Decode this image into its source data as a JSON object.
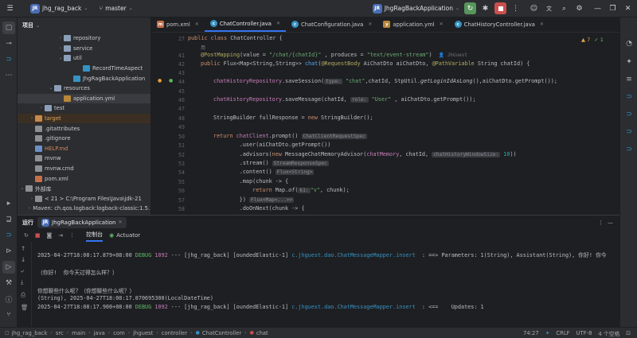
{
  "titlebar": {
    "project_badge": "JR",
    "project_name": "jhg_rag_back",
    "branch": "master",
    "run_config_badge": "JR",
    "run_config": "JhgRagBackApplication"
  },
  "project_panel": {
    "title": "项目",
    "rows": [
      {
        "label": "repository",
        "type": "folder",
        "arrow": "›",
        "indent": 50
      },
      {
        "label": "service",
        "type": "folder",
        "arrow": "›",
        "indent": 50
      },
      {
        "label": "util",
        "type": "folder",
        "arrow": "⌄",
        "indent": 50
      },
      {
        "label": "RecordTimeAspect",
        "type": "java",
        "arrow": "",
        "indent": 74
      },
      {
        "label": "JhgRagBackApplication",
        "type": "java",
        "arrow": "",
        "indent": 62
      },
      {
        "label": "resources",
        "type": "folder",
        "arrow": "⌄",
        "indent": 38
      },
      {
        "label": "application.yml",
        "type": "yml",
        "arrow": "",
        "indent": 50
      },
      {
        "label": "test",
        "type": "folder",
        "arrow": "›",
        "indent": 26
      },
      {
        "label": "target",
        "type": "folder-orange",
        "arrow": "›",
        "indent": 14
      },
      {
        "label": ".gitattributes",
        "type": "file",
        "arrow": "",
        "indent": 14
      },
      {
        "label": ".gitignore",
        "type": "file",
        "arrow": "",
        "indent": 14
      },
      {
        "label": "HELP.md",
        "type": "md",
        "arrow": "",
        "indent": 14
      },
      {
        "label": "mvnw",
        "type": "file",
        "arrow": "",
        "indent": 14
      },
      {
        "label": "mvnw.cmd",
        "type": "file",
        "arrow": "",
        "indent": 14
      },
      {
        "label": "pom.xml",
        "type": "xml",
        "arrow": "",
        "indent": 14
      },
      {
        "label": "外部库",
        "type": "lib",
        "arrow": "⌄",
        "indent": 2
      },
      {
        "label": "< 21 > C:\\Program Files\\Java\\jdk-21",
        "type": "lib",
        "arrow": "›",
        "indent": 14
      },
      {
        "label": "Maven: ch.qos.logback:logback-classic:1.5.1",
        "type": "lib",
        "arrow": "›",
        "indent": 14
      }
    ]
  },
  "tabs": [
    {
      "label": "pom.xml",
      "icon": "m"
    },
    {
      "label": "ChatController.java",
      "icon": "c",
      "active": true
    },
    {
      "label": "ChatConfiguration.java",
      "icon": "c"
    },
    {
      "label": "application.yml",
      "icon": "y"
    },
    {
      "label": "ChatHistoryController.java",
      "icon": "c"
    }
  ],
  "editor": {
    "warnings": "▲ 7",
    "ok": "✓ 1",
    "line_numbers": [
      "27",
      "",
      "41",
      "42",
      "43",
      "44",
      "45",
      "46",
      "47",
      "48",
      "49",
      "50",
      "51",
      "52",
      "53",
      "54",
      "55",
      "56",
      "57",
      "58",
      "59"
    ],
    "code": {
      "l27_kw": "public class",
      "l27_rest": " ChatController {",
      "usage": "用",
      "l41_ann": "@PostMapping",
      "l41_a": "(value = ",
      "l41_str": "\"/chat/{chatId}\"",
      "l41_b": " , produces = ",
      "l41_str2": "\"text/event-stream\"",
      "l41_c": ")",
      "l41_author": "JhGuest",
      "l42_kw": "public",
      "l42_a": " Flux<Map<String,String>> ",
      "l42_fn": "chat",
      "l42_b": "(",
      "l42_ann": "@RequestBody",
      "l42_c": " AiChatDto aiChatDto, ",
      "l42_ann2": "@PathVariable",
      "l42_d": " String chatId) {",
      "l44_fld": "chatHistoryRepository",
      "l44_a": ".saveSession(",
      "l44_hint": "type:",
      "l44_str": " \"chat\"",
      "l44_b": ",chatId, StpUtil.",
      "l44_it": "getLoginIdAsLong",
      "l44_c": "(),aiChatDto.getPrompt());",
      "l46_fld": "chatHistoryRepository",
      "l46_a": ".saveMessage(chatId, ",
      "l46_hint": "role:",
      "l46_str": " \"User\"",
      "l46_b": " , aiChatDto.getPrompt());",
      "l48_a": "StringBuilder fullResponse = ",
      "l48_kw": "new",
      "l48_b": " StringBuilder();",
      "l50_kw": "return",
      "l50_fld": " chatClient",
      "l50_a": ".prompt()",
      "l50_hint": "ChatClientRequestSpec",
      "l51": "        .user(aiChatDto.getPrompt())",
      "l52_a": "        .advisors(",
      "l52_kw": "new",
      "l52_b": " MessageChatMemoryAdvisor(",
      "l52_fld": "chatMemory",
      "l52_c": ", chatId, ",
      "l52_hint": "chatHistoryWindowSize:",
      "l52_num": " 10",
      "l52_d": "))",
      "l53": "        .stream()",
      "l53_hint": "StreamResponseSpec",
      "l54": "        .content()",
      "l54_hint": "Flux<String>",
      "l55": "        .map(chunk -> {",
      "l56_kw": "            return",
      "l56_a": " Map.",
      "l56_it": "of",
      "l56_b": "(",
      "l56_hint": "k1:",
      "l56_str": "\"v\"",
      "l56_c": ", chunk);",
      "l57": "        })",
      "l57_hint": "Flux<Map<...>>",
      "l58": "        .doOnNext(chunk -> {"
    }
  },
  "run_panel": {
    "title": "运行",
    "config": "JhgRagBackApplication",
    "tab_console": "控制台",
    "tab_actuator": "Actuator",
    "logs": {
      "l1_time": "2025-04-27T18:08:17.879+08:00",
      "l1_level": "DEBUG",
      "l1_pid": "1092",
      "l1_mid": " --- [jhg_rag_back] [oundedElastic-1] ",
      "l1_class": "c.jhguest.dao.ChatMessageMapper.insert",
      "l1_msg": "  : ==> Parameters: 1(String), Assistant(String), 你好! 你今",
      "l2": "（你好!  你今天过得怎么样？）",
      "l3": "你想聊些什么呢？（你想聊些什么呢？）",
      "l4": "(String), 2025-04-27T18:08:17.870695300(LocalDateTime)",
      "l5_time": "2025-04-27T18:08:17.900+08:00",
      "l5_level": "DEBUG",
      "l5_pid": "1092",
      "l5_mid": " --- [jhg_rag_back] [oundedElastic-1] ",
      "l5_class": "c.jhguest.dao.ChatMessageMapper.insert",
      "l5_msg": "  : <==    Updates: 1"
    }
  },
  "statusbar": {
    "breadcrumb": [
      "jhg_rag_back",
      "src",
      "main",
      "java",
      "com",
      "jhguest",
      "controller",
      "ChatController",
      "chat"
    ],
    "position": "74:27",
    "line_ending": "CRLF",
    "encoding": "UTF-8",
    "indent": "4 个空格"
  }
}
